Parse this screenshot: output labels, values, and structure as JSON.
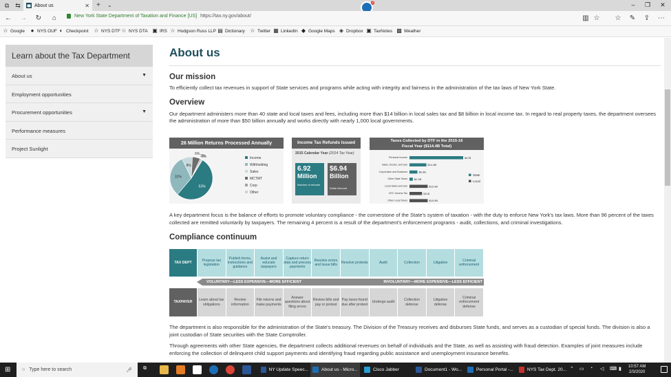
{
  "browser": {
    "tab_title": "About us",
    "cert_label": "New York State Department of Taxation and Finance [US]",
    "url": "https://tax.ny.gov/about/",
    "ext_badge_count": "2"
  },
  "favorites": [
    {
      "label": "Google",
      "icon": "star-icon"
    },
    {
      "label": "NYS OUF",
      "icon": "globe-icon"
    },
    {
      "label": "Checkpoint",
      "icon": "checkpoint-icon"
    },
    {
      "label": "NYS DTF",
      "icon": "star-icon"
    },
    {
      "label": "NYS DTA",
      "icon": "star-icon"
    },
    {
      "label": "IRS",
      "icon": "irs-icon"
    },
    {
      "label": "Hodgson Russ LLP",
      "icon": "star-icon"
    },
    {
      "label": "Dictionary",
      "icon": "book-icon"
    },
    {
      "label": "Twitter",
      "icon": "star-icon"
    },
    {
      "label": "LinkedIn",
      "icon": "linkedin-icon"
    },
    {
      "label": "Google Maps",
      "icon": "maps-icon"
    },
    {
      "label": "Dropbox",
      "icon": "dropbox-icon"
    },
    {
      "label": "TaxNotes",
      "icon": "taxnotes-icon"
    },
    {
      "label": "Weather",
      "icon": "weather-icon"
    }
  ],
  "sidebar": {
    "title": "Learn about the Tax Department",
    "items": [
      {
        "label": "About us",
        "has_caret": true
      },
      {
        "label": "Employment opportunities",
        "has_caret": false
      },
      {
        "label": "Procurement opportunities",
        "has_caret": true
      },
      {
        "label": "Performance measures",
        "has_caret": false
      },
      {
        "label": "Project Sunlight",
        "has_caret": false
      }
    ]
  },
  "main": {
    "title": "About us",
    "mission_heading": "Our mission",
    "mission_text": "To efficiently collect tax revenues in support of State services and programs while acting with integrity and fairness in the administration of the tax laws of New York State.",
    "overview_heading": "Overview",
    "overview_text": "Our department administers more than 40 state and local taxes and fees, including more than $14 billion in local sales tax and $8 billion in local income tax. In regard to real property taxes, the department oversees the administration of more than $50 billion annually and works directly with nearly 1,000 local governments.",
    "focus_text": "A key department focus is the balance of efforts to promote voluntary compliance - the cornerstone of the State's system of taxation - with the duty to enforce New York's tax laws. More than 96 percent of the taxes collected are remitted voluntarily by taxpayers. The remaining 4 percent is a result of the department's enforcement programs - audit, collections, and criminal investigations.",
    "compliance_heading": "Compliance continuum",
    "treasury_text": "The department is also responsible for the administration of the State's treasury. The Division of the Treasury receives and disburses State funds, and serves as a custodian of special funds. The division is also a joint custodian of State securities with the State Comptroller.",
    "agencies_text": "Through agreements with other State agencies, the department collects additional revenues on behalf of individuals and the State, as well as assisting with fraud detection. Examples of joint measures include enforcing the collection of delinquent child support payments and identifying fraud regarding public assistance and unemployment insurance benefits."
  },
  "infographic_returns": {
    "title": "26 Million Returns Processed Annually",
    "slices": [
      {
        "label": "Income",
        "value": 53,
        "display": "53%",
        "color": "#2b7b82"
      },
      {
        "label": "Withholding",
        "value": 32,
        "display": "32%",
        "color": "#8fb8bd"
      },
      {
        "label": "Sales",
        "value": 8,
        "display": "8%",
        "color": "#c7d9dc"
      },
      {
        "label": "MCTMT",
        "value": 6,
        "display": "6%",
        "color": "#6d6d6d"
      },
      {
        "label": "Corp",
        "value": 1,
        "display": "1%",
        "color": "#a3a3a3"
      },
      {
        "label": "Other",
        "value": 1,
        "display": "1%",
        "color": "#d3d3d3"
      }
    ]
  },
  "infographic_refunds": {
    "title": "Income Tax Refunds Issued",
    "subtitle": "2015 Calendar Year",
    "subtitle_note": "(2014 Tax Year)",
    "left_value": "6.92",
    "left_unit": "Million",
    "left_caption": "Number of refunds",
    "right_value": "$6.94",
    "right_unit": "Billion",
    "right_caption": "Dollar Amount"
  },
  "infographic_collected": {
    "title": "Taxes Collected by DTF in the 2015-16",
    "title2": "Fiscal Year ($114.4B Total)",
    "legend": [
      {
        "label": "State",
        "color": "#2b7b82"
      },
      {
        "label": "Local",
        "color": "#4f4f4f"
      }
    ],
    "chart_data": {
      "type": "bar",
      "orientation": "horizontal",
      "title": "Taxes Collected by DTF in the 2015-16 Fiscal Year ($114.4B Total)",
      "categories": [
        "Personal Income",
        "Sales, Excise, and Use",
        "Corporation and Business",
        "Other State Taxes",
        "Local Sales and Use",
        "NYC Income Tax",
        "Other Local Taxes"
      ],
      "series_kind": [
        "State",
        "State",
        "State",
        "State",
        "Local",
        "Local",
        "Local"
      ],
      "values": [
        47,
        14.8,
        6.9,
        2.9,
        15.9,
        11,
        15.9
      ],
      "labels": [
        "$47B",
        "$14.8B",
        "$6.9B",
        "$2.9B",
        "$15.9B",
        "$11B",
        "$15.9B"
      ]
    }
  },
  "continuum": {
    "top_head": "TAX DEPT",
    "top_steps": [
      "Propose tax legislation",
      "Publish forms, instructions and guidance",
      "Assist and educate taxpayers",
      "Capture return data and process payments",
      "Resolve errors and issue bills",
      "Resolve protests",
      "Audit",
      "Collection",
      "Litigation",
      "Criminal enforcement"
    ],
    "left_label": "VOLUNTARY—LESS EXPENSIVE—MORE EFFICIENT",
    "right_label": "INVOLUNTARY—MORE EXPENSIVE—LESS EFFICIENT",
    "bottom_head": "TAXPAYER",
    "bottom_steps": [
      "Learn about tax obligations",
      "Review information",
      "File returns and make payments",
      "Answer questions about filing errors",
      "Review bills and pay or protest",
      "Pay taxes found due after protest",
      "Undergo audit",
      "Collection defense",
      "Litigation defense",
      "Criminal enforcement defense"
    ]
  },
  "taskbar": {
    "search_placeholder": "Type here to search",
    "tasks": [
      {
        "label": "NY Update Speec...",
        "icon_color": "#2b5797",
        "active": false
      },
      {
        "label": "About us - Micro...",
        "icon_color": "#1c6fb6",
        "active": true
      },
      {
        "label": "Cisco Jabber",
        "icon_color": "#2a9fd6",
        "active": false
      },
      {
        "label": "Document1 - Wo...",
        "icon_color": "#2b5797",
        "active": false
      },
      {
        "label": "Personal Portal -...",
        "icon_color": "#1c6fb6",
        "active": false
      },
      {
        "label": "NYS Tax Dept. 20...",
        "icon_color": "#c7302a",
        "active": false
      }
    ],
    "time": "10:57 AM",
    "date": "2/3/2020"
  }
}
